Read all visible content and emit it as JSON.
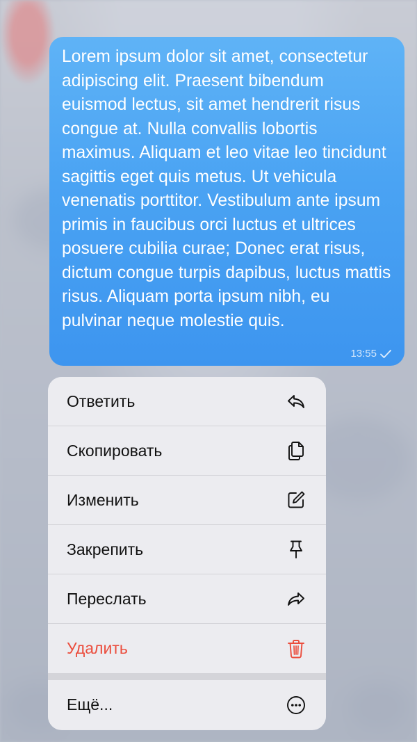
{
  "message": {
    "text": "Lorem ipsum dolor sit amet, consectetur adipiscing elit. Praesent bibendum euismod lectus, sit amet hendrerit risus congue at. Nulla convallis lobortis maximus. Aliquam et leo vitae leo tincidunt sagittis eget quis metus. Ut vehicula venenatis porttitor. Vestibulum ante ipsum primis in faucibus orci luctus et ultrices posuere cubilia curae; Donec erat risus, dictum congue turpis dapibus, luctus mattis risus. Aliquam porta ipsum nibh, eu pulvinar neque molestie quis.",
    "time": "13:55",
    "status_icon": "check-icon",
    "bubble_color": "#4aa3f3"
  },
  "context_menu": {
    "items": [
      {
        "label": "Ответить",
        "icon": "reply-icon"
      },
      {
        "label": "Скопировать",
        "icon": "copy-icon"
      },
      {
        "label": "Изменить",
        "icon": "edit-icon"
      },
      {
        "label": "Закрепить",
        "icon": "pin-icon"
      },
      {
        "label": "Переслать",
        "icon": "forward-icon"
      },
      {
        "label": "Удалить",
        "icon": "trash-icon",
        "color": "#eb4d3d"
      }
    ],
    "more": {
      "label": "Ещё...",
      "icon": "more-icon"
    }
  }
}
